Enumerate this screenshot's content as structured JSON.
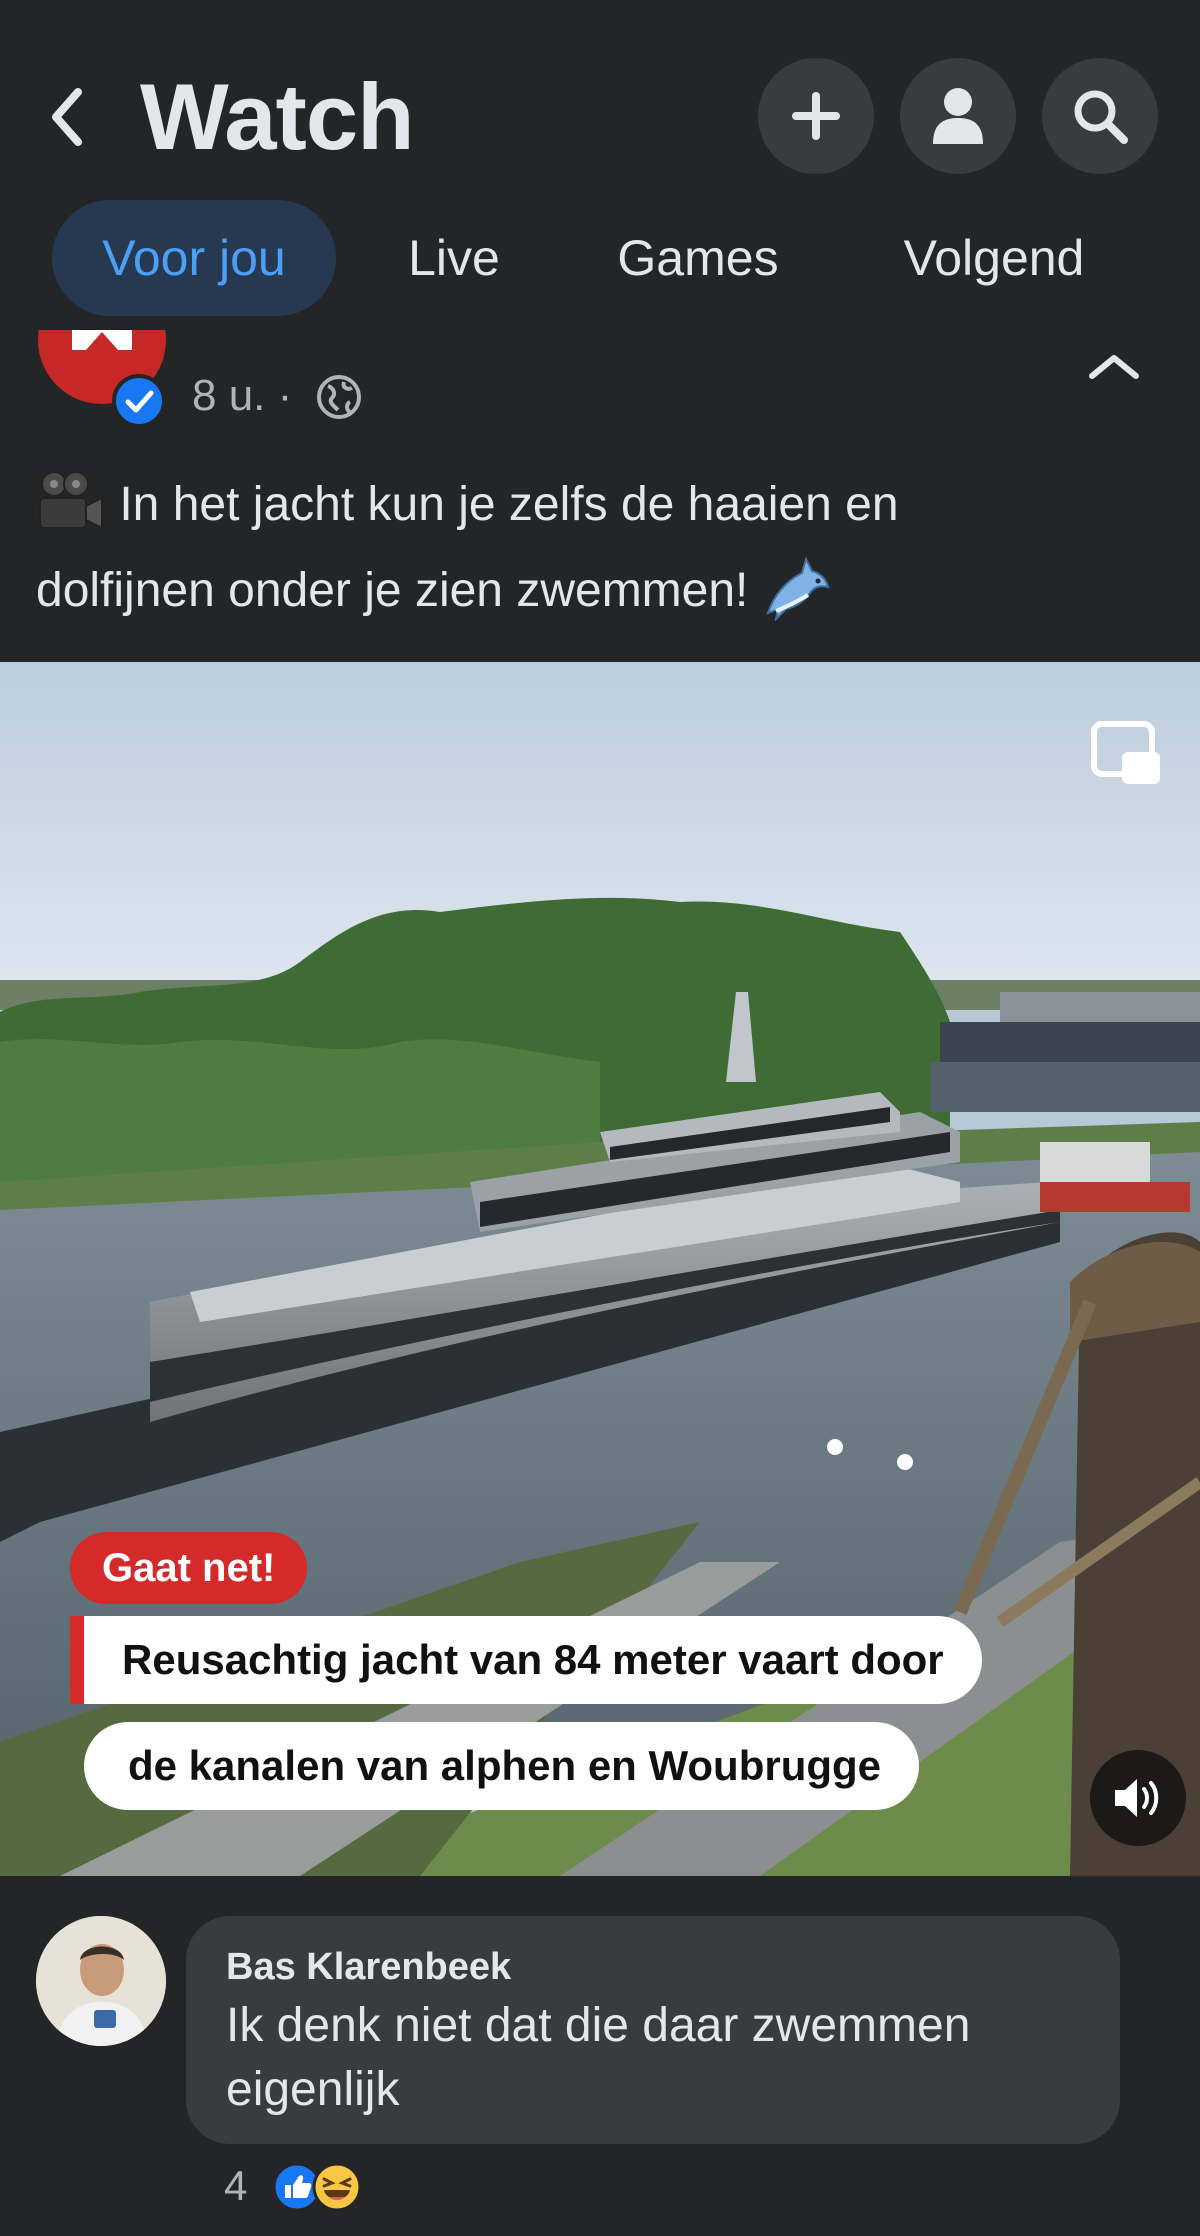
{
  "header": {
    "title": "Watch",
    "icons": [
      "back-icon",
      "plus-icon",
      "profile-icon",
      "search-icon"
    ]
  },
  "tabs": [
    {
      "label": "Voor jou",
      "active": true
    },
    {
      "label": "Live",
      "active": false
    },
    {
      "label": "Games",
      "active": false
    },
    {
      "label": "Volgend",
      "active": false
    }
  ],
  "post": {
    "time": "8 u. ·",
    "caption_line1": "In het jacht kun je zelfs de haaien en",
    "caption_line2": "dolfijnen onder je zien zwemmen!",
    "caption_emoji_start": "movie-camera-emoji",
    "caption_emoji_end": "dolphin-emoji"
  },
  "video": {
    "badge": "Gaat net!",
    "headline_line1": "Reusachtig jacht van 84 meter vaart door",
    "headline_line2": "de kanalen van alphen en Woubrugge",
    "accent_color": "#d42a2a"
  },
  "comment": {
    "author": "Bas Klarenbeek",
    "text": "Ik denk niet dat die daar zwemmen eigenlijk",
    "reaction_count": "4",
    "reactions": [
      "like-icon",
      "haha-icon"
    ]
  },
  "colors": {
    "background": "#242526",
    "tab_active_bg": "#263951",
    "tab_active_text": "#4d9ef5",
    "bubble": "#3a3b3c"
  }
}
